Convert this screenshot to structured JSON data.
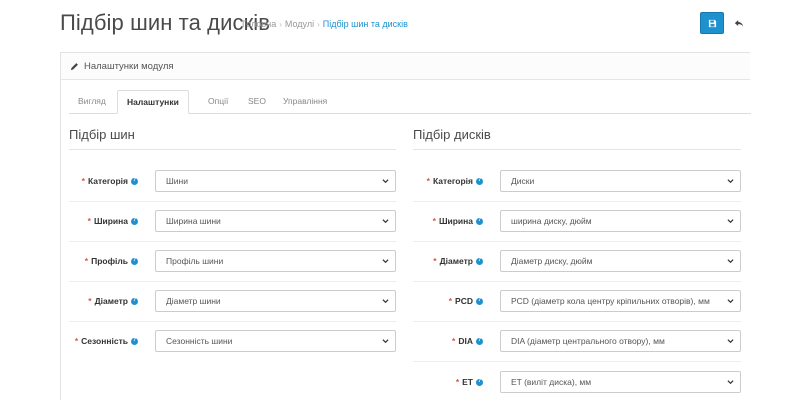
{
  "header": {
    "title": "Підбір шин та дисків",
    "breadcrumb": [
      {
        "label": "Головна"
      },
      {
        "label": "Модулі"
      },
      {
        "label": "Підбір шин та дисків"
      }
    ],
    "save_icon": "save-icon",
    "back_icon": "reply-icon"
  },
  "panel": {
    "heading": "Налаштунки модуля",
    "heading_icon": "pencil-icon"
  },
  "tabs": [
    {
      "label": "Вигляд"
    },
    {
      "label": "Налаштунки",
      "active": true
    },
    {
      "label": "Опції"
    },
    {
      "label": "SEO"
    },
    {
      "label": "Управління"
    }
  ],
  "tires": {
    "title": "Підбір шин",
    "fields": [
      {
        "label": "Категорія",
        "value": "Шини",
        "required": true
      },
      {
        "label": "Ширина",
        "value": "Ширина шини",
        "required": true
      },
      {
        "label": "Профіль",
        "value": "Профіль шини",
        "required": true
      },
      {
        "label": "Діаметр",
        "value": "Діаметр шини",
        "required": true
      },
      {
        "label": "Сезонність",
        "value": "Сезонність шини",
        "required": true
      }
    ]
  },
  "disks": {
    "title": "Підбір дисків",
    "fields": [
      {
        "label": "Категорія",
        "value": "Диски",
        "required": true
      },
      {
        "label": "Ширина",
        "value": "ширина диску, дюйм",
        "required": true
      },
      {
        "label": "Діаметр",
        "value": "Діаметр диску, дюйм",
        "required": true
      },
      {
        "label": "PCD",
        "value": "PCD (діаметр кола центру кріпильних отворів), мм",
        "required": true
      },
      {
        "label": "DIA",
        "value": "DIA (діаметр центрального отвору), мм",
        "required": true
      },
      {
        "label": "ET",
        "value": "ET (виліт диска), мм",
        "required": true
      }
    ]
  },
  "required_mark": "*",
  "colors": {
    "primary": "#1e91cf",
    "required": "#d9534f"
  }
}
